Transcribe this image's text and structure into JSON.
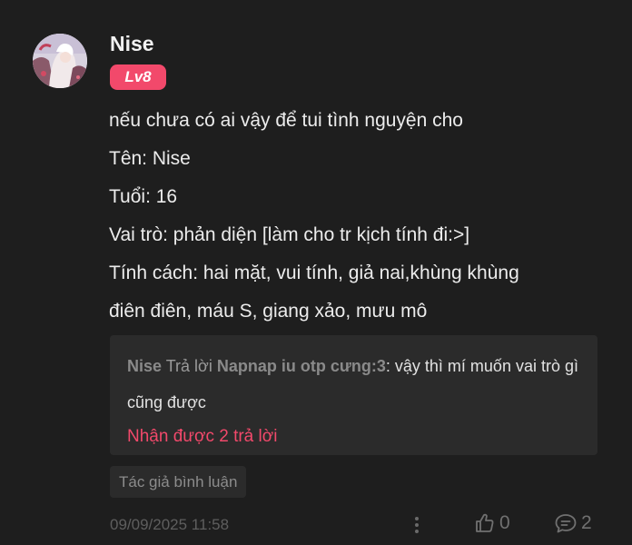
{
  "comment": {
    "username": "Nise",
    "level": "Lv8",
    "lines": [
      "nếu chưa có ai vậy để tui tình nguyện cho",
      "Tên: Nise",
      "Tuổi: 16",
      "Vai trò: phản diện [làm cho tr kịch tính đi:>]",
      "Tính cách: hai mặt, vui tính, giả nai,khùng khùng",
      "điên điên, máu S, giang xảo, mưu mô"
    ],
    "reply": {
      "author": "Nise",
      "verb": "Trả lời",
      "target": "Napnap iu otp cưng:3",
      "text": ": vậy thì mí muốn vai trò gì cũng được",
      "more_replies": "Nhận được 2 trả lời"
    },
    "author_tag": "Tác giả bình luận",
    "timestamp": "09/09/2025 11:58",
    "like_count": "0",
    "reply_count": "2",
    "icons": {
      "more": "more-vertical-icon",
      "like": "thumbs-up-icon",
      "reply": "comment-bubble-icon"
    },
    "colors": {
      "accent": "#f2496b",
      "background": "#1e1e1e",
      "panel": "#2b2b2b"
    }
  }
}
